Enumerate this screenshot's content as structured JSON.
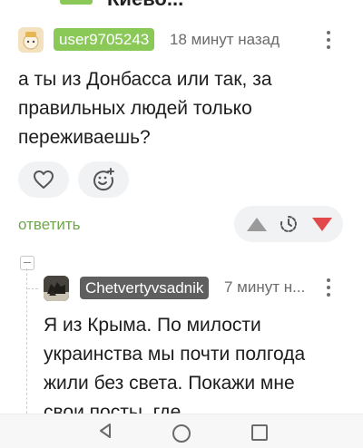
{
  "top": {
    "title": "Киево..."
  },
  "comments": [
    {
      "username": "user9705243",
      "time": "18 минут назад",
      "text": "а ты из Донбасса или так, за правильных людей только переживаешь?",
      "reply_label": "ответить"
    },
    {
      "username": "Chetvertyvsadnik",
      "time": "7 минут н...",
      "text": "Я из Крыма. По милости украинства мы почти полгода жили без света. Покажи мне свои посты, где"
    }
  ],
  "colors": {
    "accent_green": "#8ac858",
    "link_green": "#6fa84a",
    "downvote_red": "#e2494a",
    "upvote_gray": "#9a9a9a",
    "badge_gray": "#5f5f5f"
  },
  "icons": {
    "reaction_like": "heart-icon",
    "reaction_add": "emoji-add-icon",
    "vote_up": "upvote-triangle-icon",
    "vote_pending": "clock-icon",
    "vote_down": "downvote-triangle-icon",
    "more": "more-vertical-icon",
    "collapse": "collapse-minus-icon",
    "nav_back": "back-triangle-icon",
    "nav_home": "home-circle-icon",
    "nav_recent": "recent-square-icon"
  }
}
